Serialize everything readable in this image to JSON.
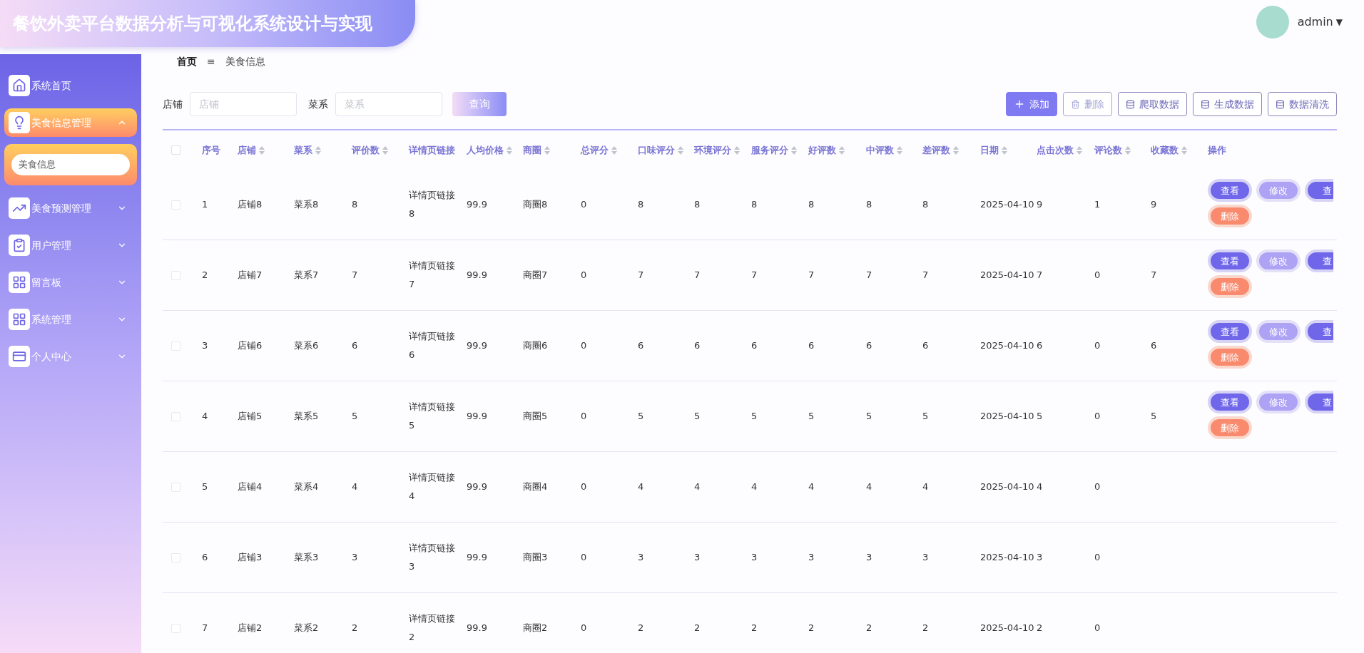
{
  "header": {
    "title": "餐饮外卖平台数据分析与可视化系统设计与实现",
    "user": "admin",
    "caret": "▼"
  },
  "sidebar": {
    "items": [
      {
        "label": "系统首页",
        "expandable": false,
        "expanded": false
      },
      {
        "label": "美食信息管理",
        "expandable": true,
        "expanded": true,
        "children": [
          {
            "label": "美食信息",
            "selected": true
          }
        ]
      },
      {
        "label": "美食预测管理",
        "expandable": true,
        "expanded": false
      },
      {
        "label": "用户管理",
        "expandable": true,
        "expanded": false
      },
      {
        "label": "留言板",
        "expandable": true,
        "expanded": false
      },
      {
        "label": "系统管理",
        "expandable": true,
        "expanded": false
      },
      {
        "label": "个人中心",
        "expandable": true,
        "expanded": false
      }
    ]
  },
  "breadcrumb": {
    "items": [
      "首页",
      "美食信息"
    ],
    "separator": "≡"
  },
  "filters": [
    {
      "label": "店铺",
      "placeholder": "店铺"
    },
    {
      "label": "菜系",
      "placeholder": "菜系"
    }
  ],
  "query_button": "查询",
  "toolbar": [
    {
      "label": "添加",
      "kind": "primary",
      "disabled": false
    },
    {
      "label": "删除",
      "kind": "outline",
      "disabled": true
    },
    {
      "label": "爬取数据",
      "kind": "outline",
      "disabled": false
    },
    {
      "label": "生成数据",
      "kind": "outline",
      "disabled": false
    },
    {
      "label": "数据清洗",
      "kind": "outline",
      "disabled": false
    }
  ],
  "table": {
    "all_checked": false,
    "columns": [
      {
        "label": "序号",
        "sortable": false
      },
      {
        "label": "店铺",
        "sortable": true
      },
      {
        "label": "菜系",
        "sortable": true
      },
      {
        "label": "评价数",
        "sortable": true
      },
      {
        "label": "详情页链接",
        "sortable": false
      },
      {
        "label": "人均价格",
        "sortable": true
      },
      {
        "label": "商圈",
        "sortable": true
      },
      {
        "label": "总评分",
        "sortable": true
      },
      {
        "label": "口味评分",
        "sortable": true
      },
      {
        "label": "环境评分",
        "sortable": true
      },
      {
        "label": "服务评分",
        "sortable": true
      },
      {
        "label": "好评数",
        "sortable": true
      },
      {
        "label": "中评数",
        "sortable": true
      },
      {
        "label": "差评数",
        "sortable": true
      },
      {
        "label": "日期",
        "sortable": true
      },
      {
        "label": "点击次数",
        "sortable": true
      },
      {
        "label": "评论数",
        "sortable": true
      },
      {
        "label": "收藏数",
        "sortable": true
      },
      {
        "label": "操作",
        "sortable": false
      }
    ],
    "rows": [
      {
        "checked": false,
        "cells": [
          "1",
          "店铺8",
          "菜系8",
          "8",
          "详情页链接8",
          "99.9",
          "商圈8",
          "0",
          "8",
          "8",
          "8",
          "8",
          "8",
          "8",
          "2025-04-10",
          "9",
          "1",
          "9"
        ],
        "actions": [
          {
            "label": "查看",
            "kind": "view"
          },
          {
            "label": "修改",
            "kind": "edit"
          },
          {
            "label": "查",
            "kind": "view"
          },
          {
            "label": "删除",
            "kind": "delete"
          }
        ]
      },
      {
        "checked": false,
        "cells": [
          "2",
          "店铺7",
          "菜系7",
          "7",
          "详情页链接7",
          "99.9",
          "商圈7",
          "0",
          "7",
          "7",
          "7",
          "7",
          "7",
          "7",
          "2025-04-10",
          "7",
          "0",
          "7"
        ],
        "actions": [
          {
            "label": "查看",
            "kind": "view"
          },
          {
            "label": "修改",
            "kind": "edit"
          },
          {
            "label": "查",
            "kind": "view"
          },
          {
            "label": "删除",
            "kind": "delete"
          }
        ]
      },
      {
        "checked": false,
        "cells": [
          "3",
          "店铺6",
          "菜系6",
          "6",
          "详情页链接6",
          "99.9",
          "商圈6",
          "0",
          "6",
          "6",
          "6",
          "6",
          "6",
          "6",
          "2025-04-10",
          "6",
          "0",
          "6"
        ],
        "actions": [
          {
            "label": "查看",
            "kind": "view"
          },
          {
            "label": "修改",
            "kind": "edit"
          },
          {
            "label": "查",
            "kind": "view"
          },
          {
            "label": "删除",
            "kind": "delete"
          }
        ]
      },
      {
        "checked": false,
        "cells": [
          "4",
          "店铺5",
          "菜系5",
          "5",
          "详情页链接5",
          "99.9",
          "商圈5",
          "0",
          "5",
          "5",
          "5",
          "5",
          "5",
          "5",
          "2025-04-10",
          "5",
          "0",
          "5"
        ],
        "actions": [
          {
            "label": "查看",
            "kind": "view"
          },
          {
            "label": "修改",
            "kind": "edit"
          },
          {
            "label": "查",
            "kind": "view"
          },
          {
            "label": "删除",
            "kind": "delete"
          }
        ]
      },
      {
        "checked": false,
        "cells": [
          "5",
          "店铺4",
          "菜系4",
          "4",
          "详情页链接4",
          "99.9",
          "商圈4",
          "0",
          "4",
          "4",
          "4",
          "4",
          "4",
          "4",
          "2025-04-10",
          "4",
          "0"
        ]
      },
      {
        "checked": false,
        "cells": [
          "6",
          "店铺3",
          "菜系3",
          "3",
          "详情页链接3",
          "99.9",
          "商圈3",
          "0",
          "3",
          "3",
          "3",
          "3",
          "3",
          "3",
          "2025-04-10",
          "3",
          "0"
        ]
      },
      {
        "checked": false,
        "cells": [
          "7",
          "店铺2",
          "菜系2",
          "2",
          "详情页链接2",
          "99.9",
          "商圈2",
          "0",
          "2",
          "2",
          "2",
          "2",
          "2",
          "2",
          "2025-04-10",
          "2",
          "0"
        ]
      }
    ]
  }
}
